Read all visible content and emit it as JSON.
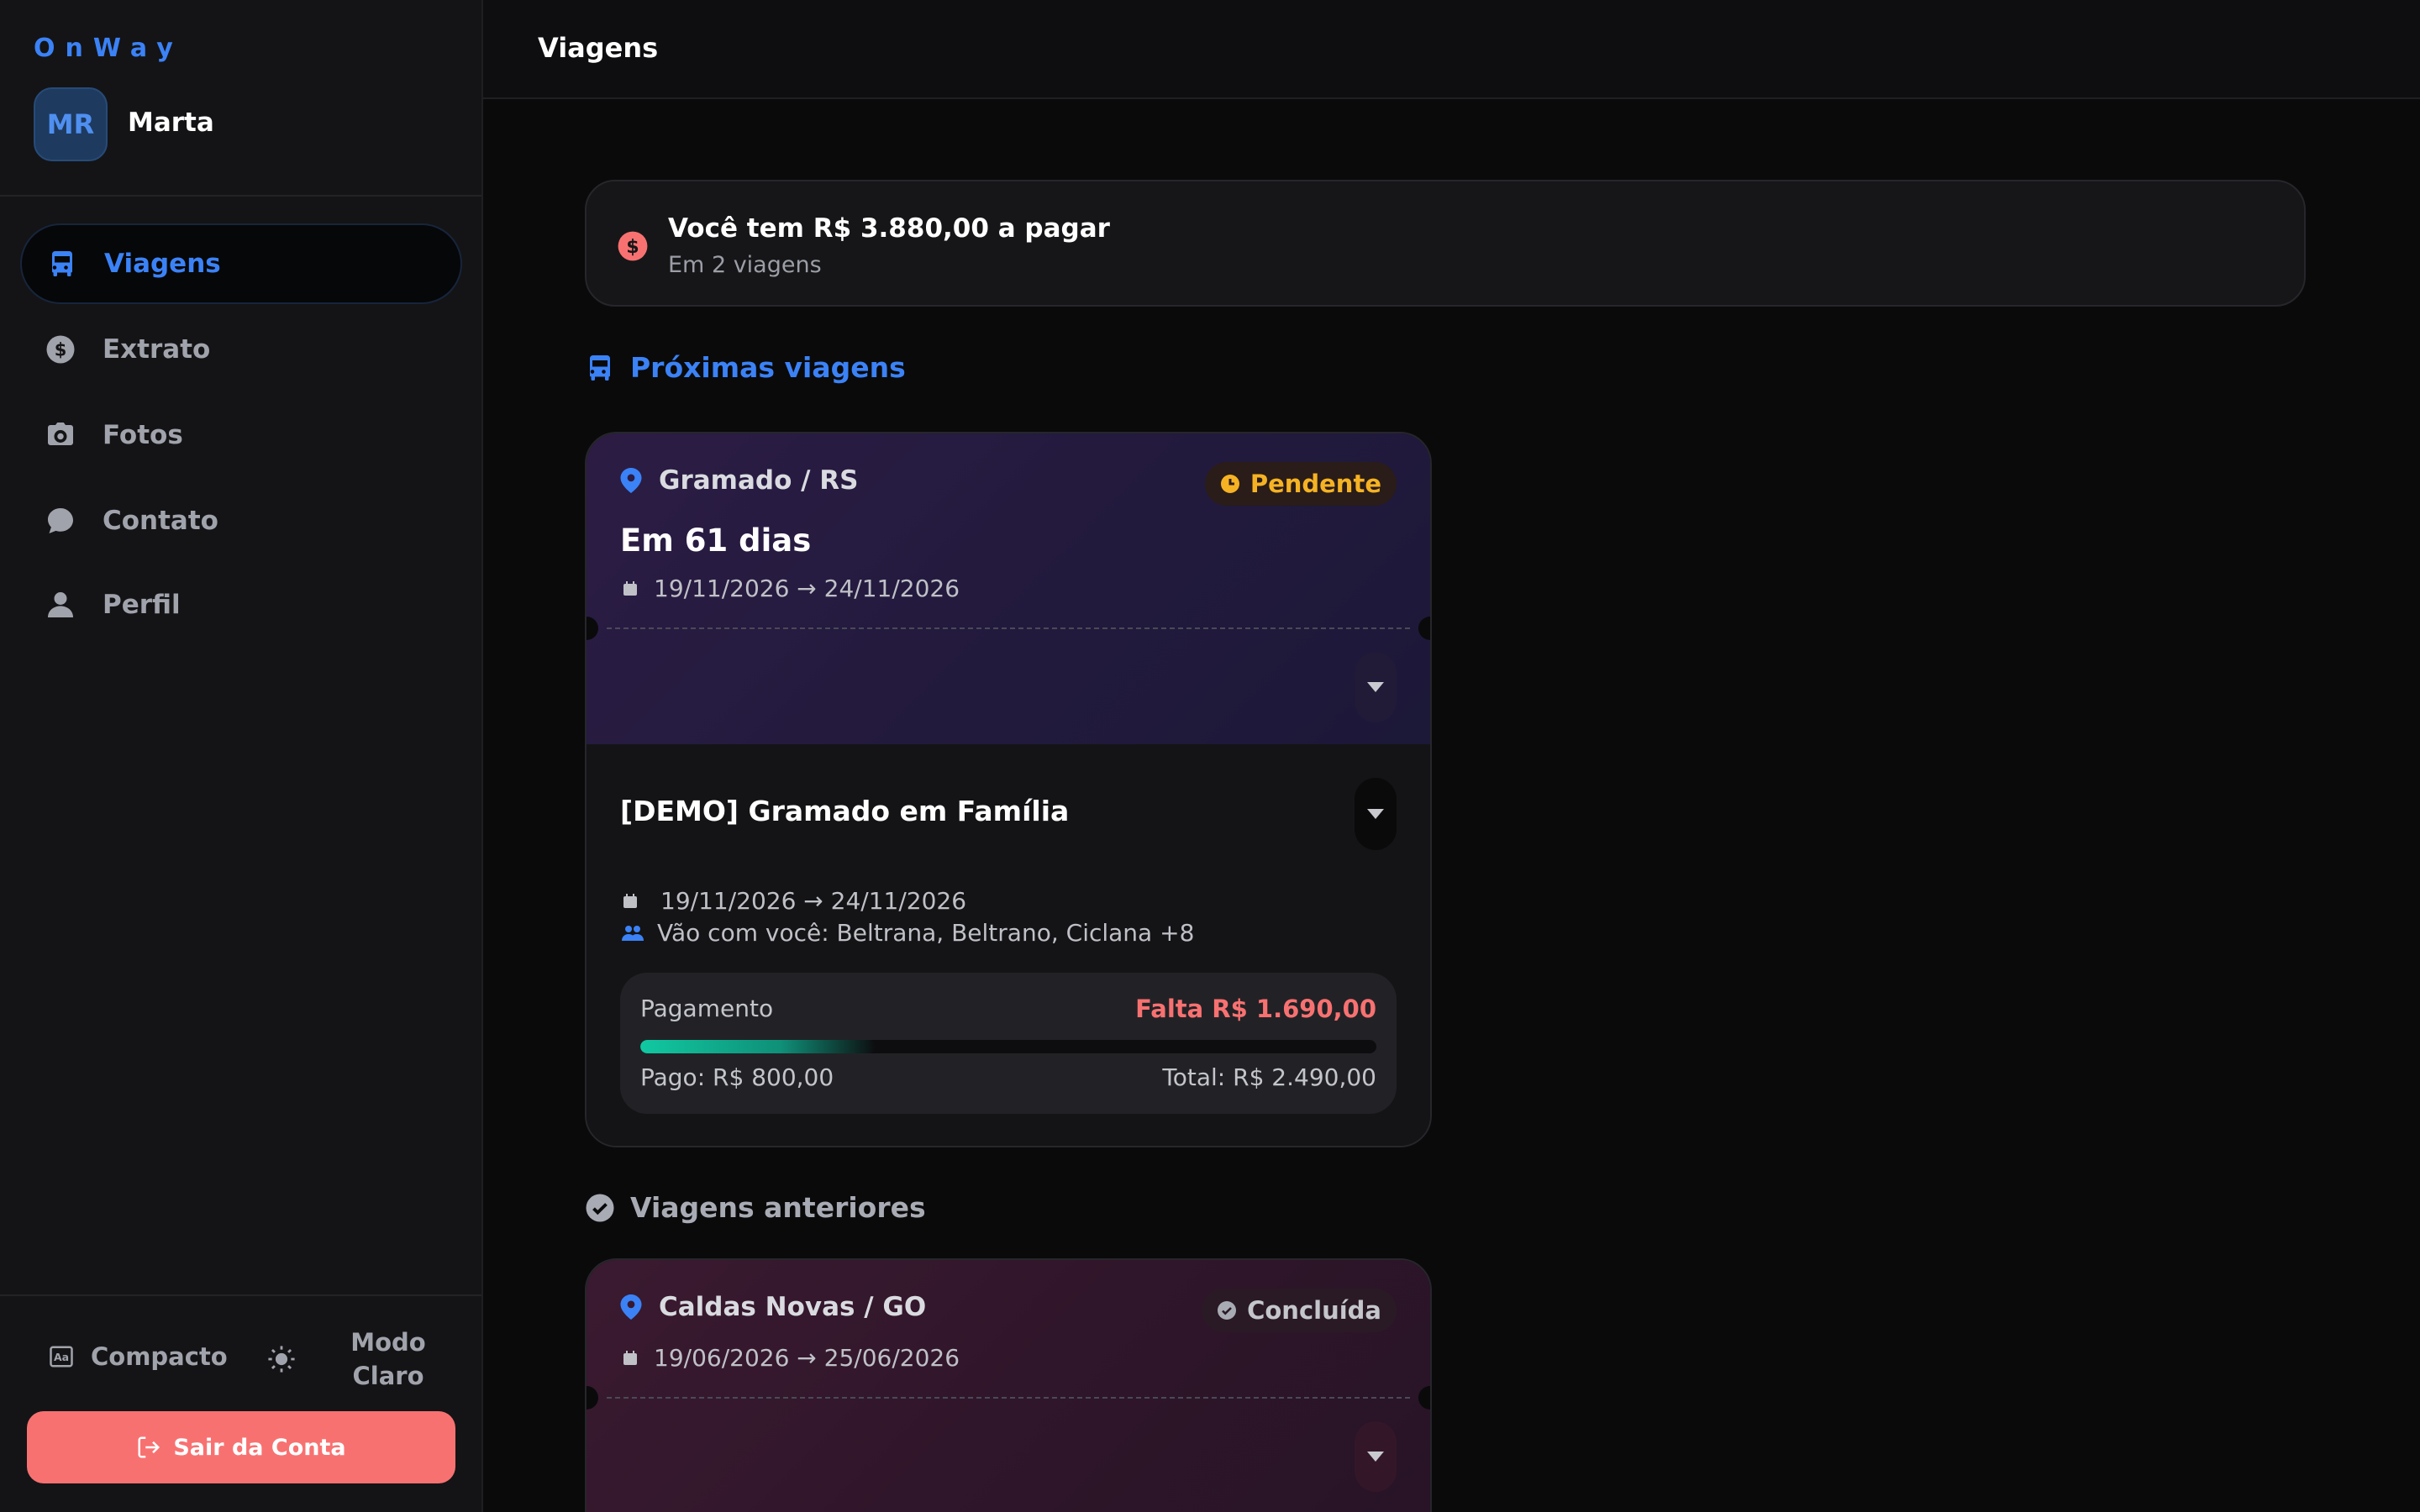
{
  "app": {
    "brand": "OnWay",
    "user": {
      "initials": "MR",
      "name": "Marta"
    }
  },
  "sidebar": {
    "items": [
      {
        "label": "Viagens",
        "icon": "bus-icon",
        "active": true
      },
      {
        "label": "Extrato",
        "icon": "dollar-circle-icon",
        "active": false
      },
      {
        "label": "Fotos",
        "icon": "camera-icon",
        "active": false
      },
      {
        "label": "Contato",
        "icon": "chat-bubble-icon",
        "active": false
      },
      {
        "label": "Perfil",
        "icon": "user-icon",
        "active": false
      }
    ],
    "compact_label": "Compacto",
    "theme_label": "Modo Claro",
    "logout_label": "Sair da Conta"
  },
  "header": {
    "title": "Viagens"
  },
  "alert": {
    "title": "Você tem R$ 3.880,00 a pagar",
    "subtitle": "Em 2 viagens",
    "icon": "dollar-circle-icon",
    "color": "#f87171"
  },
  "upcoming": {
    "section_title": "Próximas viagens",
    "trips": [
      {
        "location": "Gramado / RS",
        "status": "Pendente",
        "countdown": "Em 61 dias",
        "dates": "19/11/2026 → 24/11/2026",
        "name": "[DEMO] Gramado em Família",
        "body_dates": "19/11/2026 → 24/11/2026",
        "companions": "Vão com você: Beltrana, Beltrano, Ciclana +8",
        "payment": {
          "label": "Pagamento",
          "missing": "Falta R$ 1.690,00",
          "paid": "Pago: R$ 800,00",
          "total": "Total: R$ 2.490,00",
          "progress": 0.32
        }
      }
    ]
  },
  "past": {
    "section_title": "Viagens anteriores",
    "trips": [
      {
        "location": "Caldas Novas / GO",
        "status": "Concluída",
        "dates": "19/06/2026 → 25/06/2026"
      }
    ]
  },
  "colors": {
    "accent": "#3b82f6",
    "pending": "#f5b324",
    "danger": "#f87171",
    "progress": "#10c9a2"
  }
}
